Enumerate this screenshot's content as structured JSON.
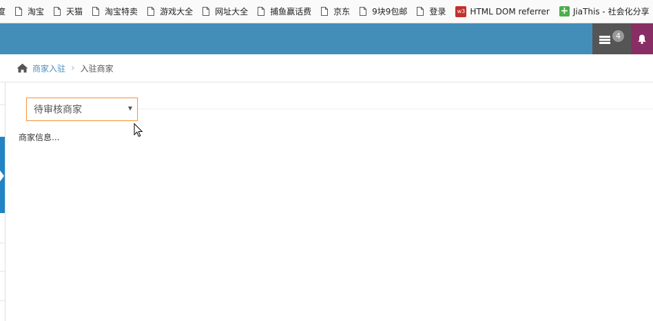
{
  "bookmarks": [
    {
      "label": "度",
      "icon": "none"
    },
    {
      "label": "淘宝",
      "icon": "page-icon"
    },
    {
      "label": "天猫",
      "icon": "page-icon"
    },
    {
      "label": "淘宝特卖",
      "icon": "page-icon"
    },
    {
      "label": "游戏大全",
      "icon": "page-icon"
    },
    {
      "label": "网址大全",
      "icon": "page-icon"
    },
    {
      "label": "捕鱼赢话费",
      "icon": "page-icon"
    },
    {
      "label": "京东",
      "icon": "page-icon"
    },
    {
      "label": "9块9包邮",
      "icon": "page-icon"
    },
    {
      "label": "登录",
      "icon": "page-icon"
    },
    {
      "label": "HTML DOM referrer",
      "icon": "w3-icon",
      "icon_text": "w3"
    },
    {
      "label": "JiaThis - 社会化分享",
      "icon": "plus-icon",
      "icon_text": "+"
    }
  ],
  "header": {
    "tasks_badge": "4",
    "accent_color": "#438eb9",
    "tasks_button_color": "#555555",
    "notify_button_color": "#892e65"
  },
  "breadcrumb": {
    "home_label": "商家入驻",
    "current": "入驻商家",
    "separator": "›"
  },
  "filter": {
    "selected": "待审核商家"
  },
  "content": {
    "info_text": "商家信息..."
  }
}
